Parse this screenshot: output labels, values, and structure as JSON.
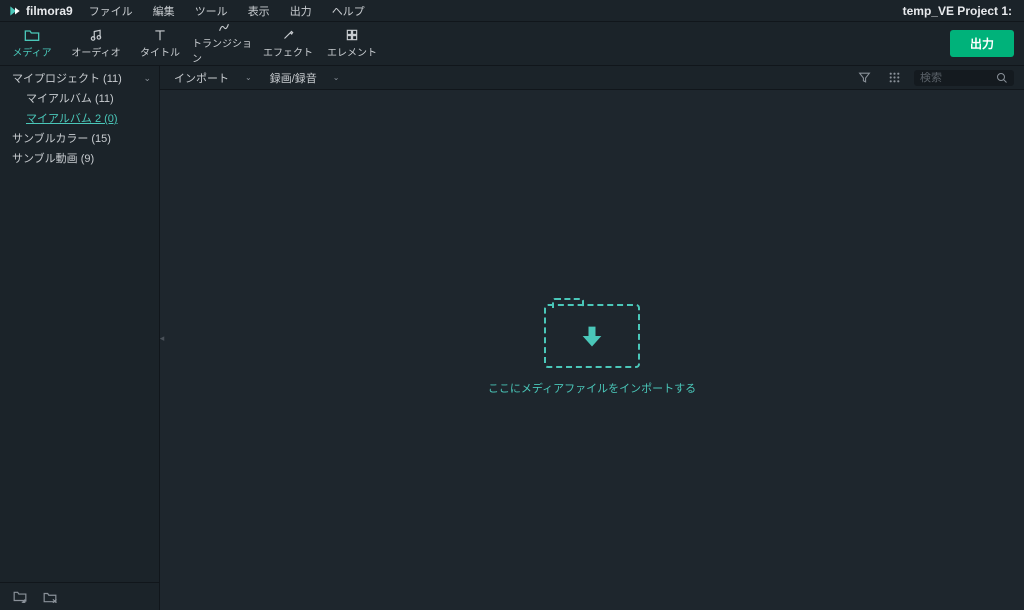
{
  "app": {
    "name": "filmora9",
    "project_title": "temp_VE Project 1:"
  },
  "menubar": {
    "items": [
      "ファイル",
      "編集",
      "ツール",
      "表示",
      "出力",
      "ヘルプ"
    ]
  },
  "toolbar": {
    "tabs": [
      {
        "label": "メディア",
        "icon": "folder-icon",
        "active": true
      },
      {
        "label": "オーディオ",
        "icon": "music-icon",
        "active": false
      },
      {
        "label": "タイトル",
        "icon": "text-icon",
        "active": false
      },
      {
        "label": "トランジション",
        "icon": "transition-icon",
        "active": false
      },
      {
        "label": "エフェクト",
        "icon": "effect-icon",
        "active": false
      },
      {
        "label": "エレメント",
        "icon": "element-icon",
        "active": false
      }
    ],
    "export_label": "出力"
  },
  "sidebar": {
    "items": [
      {
        "label": "マイプロジェクト (11)",
        "level": 0,
        "has_children": true
      },
      {
        "label": "マイアルバム (11)",
        "level": 1
      },
      {
        "label": "マイアルバム 2 (0)",
        "level": 1,
        "selected": true
      },
      {
        "label": "サンブルカラー (15)",
        "level": 0
      },
      {
        "label": "サンブル動画 (9)",
        "level": 0
      }
    ]
  },
  "content_bar": {
    "import_label": "インポート",
    "record_label": "録画/録音",
    "search_placeholder": "検索"
  },
  "dropzone": {
    "text": "ここにメディアファイルをインポートする"
  }
}
